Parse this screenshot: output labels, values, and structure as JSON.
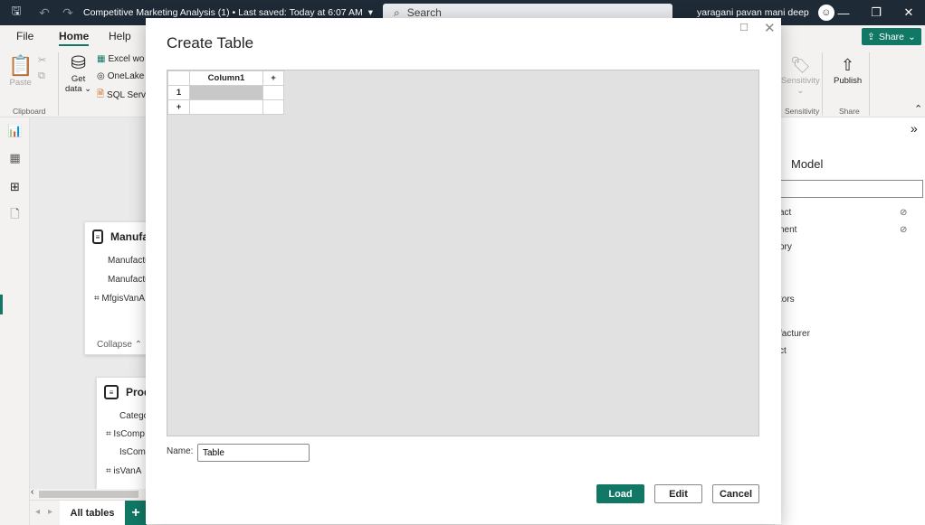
{
  "titlebar": {
    "title": "Competitive Marketing Analysis (1) • Last saved: Today at 6:07 AM",
    "search_placeholder": "Search",
    "user_name": "yaragani pavan mani deep",
    "user_avatar": "☺"
  },
  "menu": {
    "file": "File",
    "home": "Home",
    "help": "Help"
  },
  "ribbon": {
    "paste": "Paste",
    "clipboard": "Clipboard",
    "get_data": "Get",
    "get_data_2": "data",
    "excel": "Excel wo",
    "onelake": "OneLake",
    "sql": "SQL Serv",
    "sensitivity": "Sensitivity",
    "sensitivity_group": "Sensitivity",
    "publish": "Publish",
    "share_group": "Share",
    "share_button": "Share"
  },
  "canvas": {
    "card1": {
      "title": "Manufa",
      "fields": [
        "Manufactu",
        "Manufactu",
        "MfgisVanA"
      ],
      "collapse": "Collapse"
    },
    "card2": {
      "title": "Prod",
      "fields": [
        "Catego",
        "IsComp",
        "IsComp",
        "isVanA"
      ]
    },
    "tab_all": "All tables",
    "tab_add": "+"
  },
  "right_pane": {
    "title": "Model",
    "items": [
      "act",
      "nent",
      "ory",
      "tors",
      "facturer",
      "ct"
    ]
  },
  "modal": {
    "title": "Create Table",
    "grid": {
      "column_header": "Column1",
      "add_column": "+",
      "row_number": "1",
      "add_row": "+"
    },
    "name_label": "Name:",
    "name_value": "Table",
    "load": "Load",
    "edit": "Edit",
    "cancel": "Cancel"
  },
  "colors": {
    "accent": "#117865",
    "titlebar": "#1e2a36"
  }
}
